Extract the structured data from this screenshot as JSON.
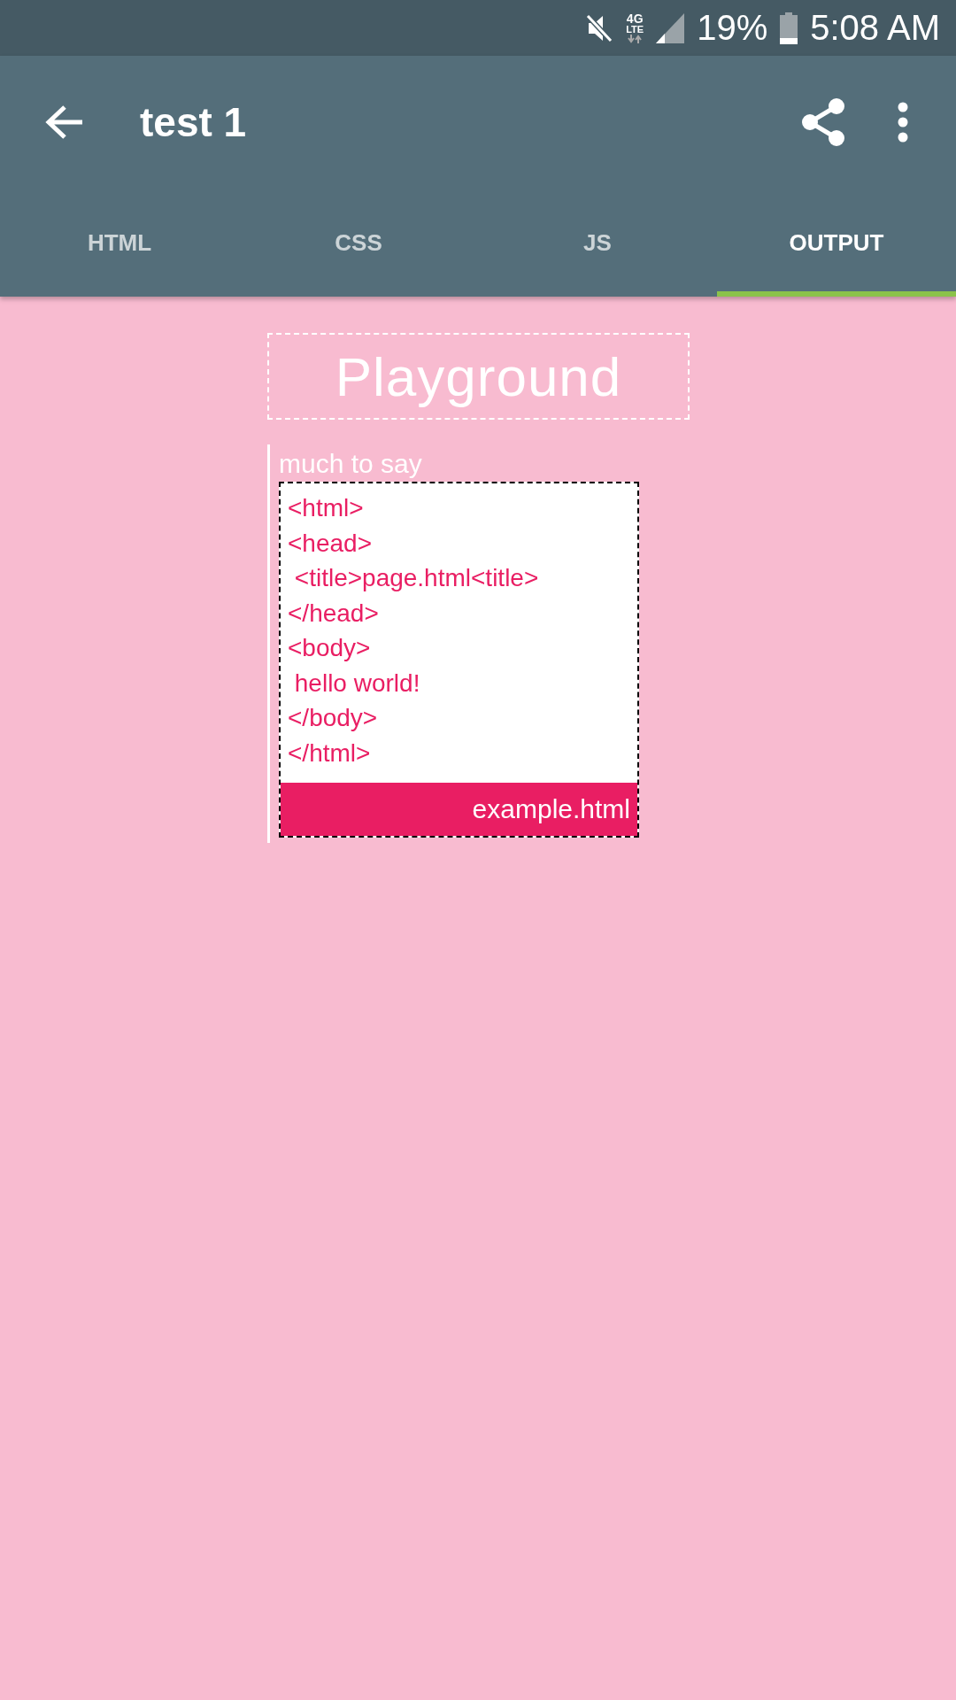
{
  "status_bar": {
    "network_top": "4G",
    "network_bottom": "LTE",
    "battery": "19%",
    "time": "5:08 AM"
  },
  "toolbar": {
    "title": "test 1"
  },
  "tabs": [
    {
      "label": "HTML",
      "selected": false
    },
    {
      "label": "CSS",
      "selected": false
    },
    {
      "label": "JS",
      "selected": false
    },
    {
      "label": "OUTPUT",
      "selected": true
    }
  ],
  "output": {
    "heading": "Playground",
    "caption": "much to say",
    "code_lines": [
      "<html>",
      "<head>",
      " <title>page.html<title>",
      "</head>",
      "<body>",
      " hello world!",
      "</body>",
      "</html>"
    ],
    "file_name": "example.html"
  }
}
